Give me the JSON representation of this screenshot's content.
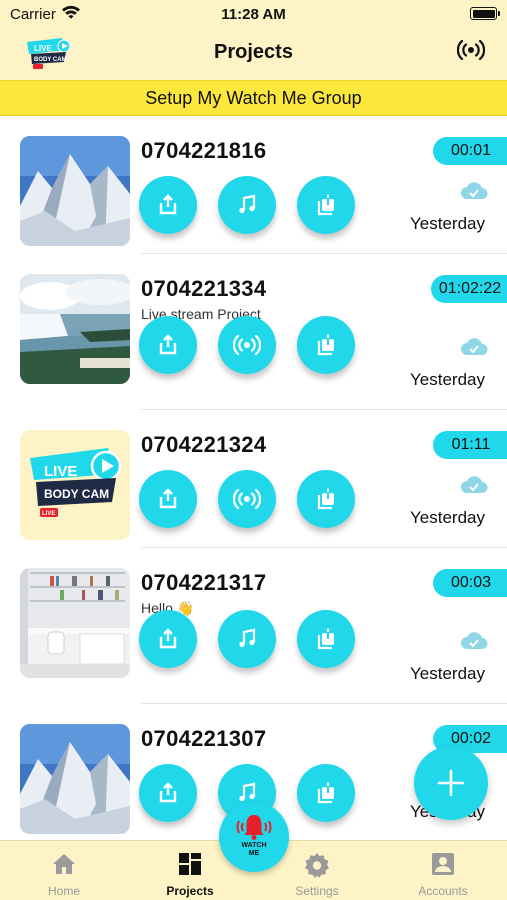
{
  "status_bar": {
    "carrier": "Carrier",
    "time": "11:28 AM"
  },
  "nav": {
    "title": "Projects",
    "logo": {
      "line1": "LIVE",
      "line2": "BODY CAM",
      "badge": "LIVE"
    },
    "right_icon": "broadcast-icon"
  },
  "banner": {
    "label": "Setup My Watch Me Group"
  },
  "projects": [
    {
      "name": "0704221816",
      "subtitle": "",
      "duration": "00:01",
      "date": "Yesterday",
      "thumbnail": "mountain",
      "actions": [
        "share-icon",
        "music-icon",
        "export-icon"
      ],
      "synced": true
    },
    {
      "name": "0704221334",
      "subtitle": "Live stream Project",
      "duration": "01:02:22",
      "date": "Yesterday",
      "thumbnail": "waterfall",
      "actions": [
        "share-icon",
        "broadcast-icon",
        "export-icon"
      ],
      "synced": true
    },
    {
      "name": "0704221324",
      "subtitle": "",
      "duration": "01:11",
      "date": "Yesterday",
      "thumbnail": "logo",
      "actions": [
        "share-icon",
        "broadcast-icon",
        "export-icon"
      ],
      "synced": true
    },
    {
      "name": "0704221317",
      "subtitle": "Hello 👋",
      "duration": "00:03",
      "date": "Yesterday",
      "thumbnail": "room",
      "actions": [
        "share-icon",
        "music-icon",
        "export-icon"
      ],
      "synced": true
    },
    {
      "name": "0704221307",
      "subtitle": "",
      "duration": "00:02",
      "date": "Yesterday",
      "thumbnail": "mountain",
      "actions": [
        "share-icon",
        "music-icon",
        "export-icon"
      ],
      "synced": false
    }
  ],
  "fab": {
    "icon": "plus-icon"
  },
  "watch_me": {
    "label_line1": "WATCH",
    "label_line2": "ME",
    "icon": "alarm-bell-icon"
  },
  "tabs": [
    {
      "label": "Home",
      "icon": "home-icon",
      "active": false
    },
    {
      "label": "Projects",
      "icon": "grid-icon",
      "active": true
    },
    {
      "label": "Settings",
      "icon": "gear-icon",
      "active": false
    },
    {
      "label": "Accounts",
      "icon": "account-icon",
      "active": false
    }
  ],
  "colors": {
    "accent": "#20d8ea",
    "header_bg": "#fdf3c6",
    "banner_bg": "#fce83c",
    "cloud": "#8fd6e6",
    "alert_red": "#e8202a"
  }
}
